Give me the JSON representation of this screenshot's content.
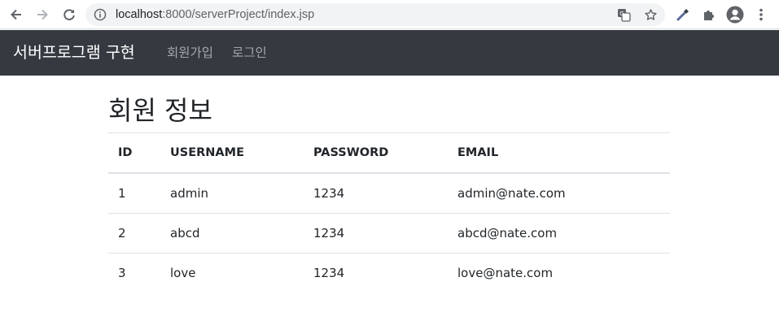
{
  "browser": {
    "url_host": "localhost",
    "url_rest": ":8000/serverProject/index.jsp"
  },
  "icons": {
    "back": "arrow-left-icon",
    "forward": "arrow-right-icon",
    "reload": "reload-icon",
    "info": "info-icon",
    "translate": "translate-icon",
    "bookmark": "star-icon",
    "eyedropper": "eyedropper-icon",
    "extensions": "puzzle-icon",
    "profile": "account-icon",
    "menu": "kebab-menu-icon"
  },
  "colors": {
    "navbar": "#343a40",
    "brand": "#ffffff",
    "nav_link": "rgba(255,255,255,0.55)",
    "table_border": "#dee2e6"
  },
  "navbar": {
    "brand": "서버프로그램 구현",
    "links": [
      "회원가입",
      "로그인"
    ]
  },
  "main": {
    "title": "회원 정보",
    "table": {
      "headers": [
        "ID",
        "USERNAME",
        "PASSWORD",
        "EMAIL"
      ],
      "rows": [
        [
          "1",
          "admin",
          "1234",
          "admin@nate.com"
        ],
        [
          "2",
          "abcd",
          "1234",
          "abcd@nate.com"
        ],
        [
          "3",
          "love",
          "1234",
          "love@nate.com"
        ]
      ]
    }
  }
}
